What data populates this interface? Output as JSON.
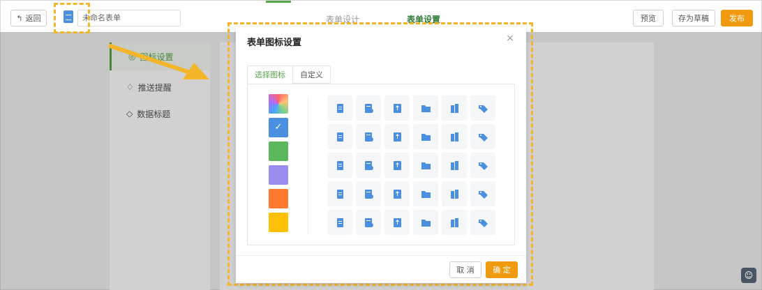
{
  "topbar": {
    "back_label": "返回",
    "form_name": "未命名表单",
    "tabs": [
      "表单设计",
      "表单设置"
    ],
    "active_tab": 1,
    "preview_label": "预览",
    "save_draft_label": "存为草稿",
    "publish_label": "发布"
  },
  "nav": {
    "items": [
      {
        "label": "图标设置",
        "icon": "settings-icon"
      },
      {
        "label": "推送提醒",
        "icon": "bell-icon"
      },
      {
        "label": "数据标题",
        "icon": "tag-icon"
      }
    ]
  },
  "dialog": {
    "title": "表单图标设置",
    "close": "×",
    "tabs": [
      "选择图标",
      "自定义"
    ],
    "colors": [
      "gradient",
      "#4a8fe0",
      "#5cb85c",
      "#9b8cf0",
      "#ff7a2f",
      "#ffc107"
    ],
    "selected_color": 1,
    "icons": [
      "document-icon",
      "document-list-icon",
      "document-upload-icon",
      "folder-icon",
      "building-icon",
      "tag-icon",
      "inbox-icon",
      "clipboard-check-icon",
      "calendar-check-icon",
      "document-clock-icon",
      "printer-icon",
      "tray-icon",
      "user-tree-icon",
      "user-edit-icon",
      "user-add-icon",
      "user-check-icon",
      "user-settings-icon",
      "user-remove-icon",
      "chart-screen-icon",
      "pie-chart-icon",
      "bar-chart-icon",
      "yen-icon",
      "clock-icon",
      "chat-icon",
      "briefcase-icon",
      "airplane-icon",
      "stamp-icon",
      "cart-icon",
      "car-icon",
      "shield-icon"
    ],
    "cancel_label": "取 消",
    "confirm_label": "确 定"
  },
  "colors": {
    "accent": "#5aa64a",
    "primary": "#f09a0f",
    "icon_blue": "#4a8fe0"
  }
}
